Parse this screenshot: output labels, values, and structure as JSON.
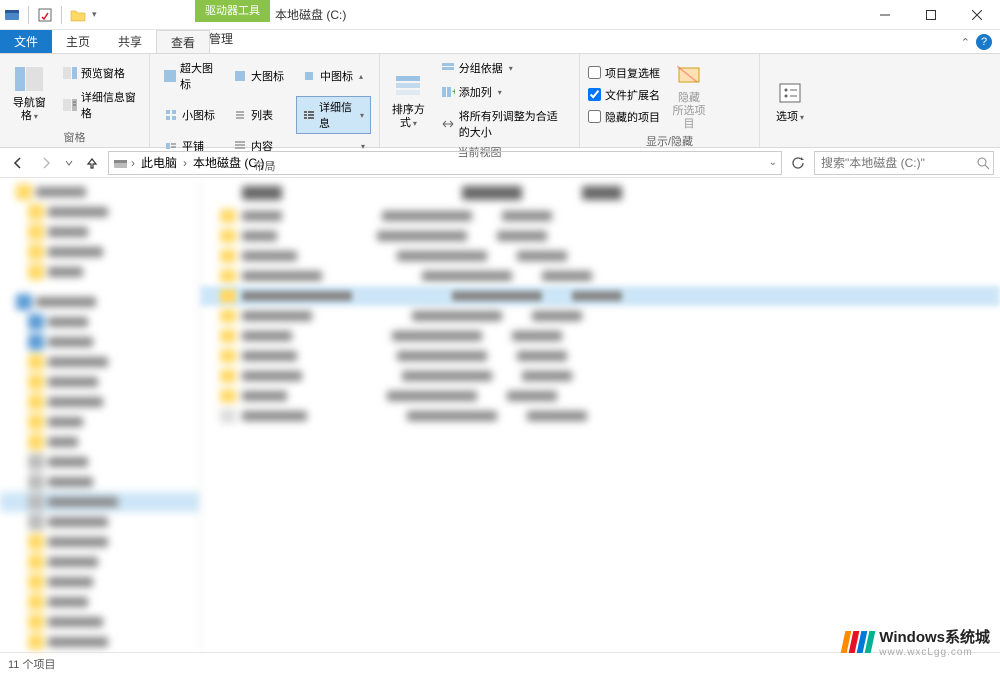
{
  "window": {
    "drive_tools": "驱动器工具",
    "title": "本地磁盘 (C:)"
  },
  "tabs": {
    "file": "文件",
    "home": "主页",
    "share": "共享",
    "view": "查看",
    "manage": "管理"
  },
  "ribbon": {
    "panes": {
      "nav_pane": "导航窗格",
      "preview_pane": "预览窗格",
      "details_pane": "详细信息窗格",
      "group_label": "窗格"
    },
    "layout": {
      "extra_large": "超大图标",
      "large": "大图标",
      "medium": "中图标",
      "small": "小图标",
      "list": "列表",
      "details": "详细信息",
      "tiles": "平铺",
      "content": "内容",
      "group_label": "布局"
    },
    "current_view": {
      "sort_by": "排序方式",
      "group_by": "分组依据",
      "add_columns": "添加列",
      "size_all": "将所有列调整为合适的大小",
      "group_label": "当前视图"
    },
    "show_hide": {
      "item_checkboxes": "项目复选框",
      "file_extensions": "文件扩展名",
      "hidden_items": "隐藏的项目",
      "checkbox_state": false,
      "ext_state": true,
      "hidden_state": false,
      "hide_selected": "隐藏",
      "hide_selected_sub": "所选项目",
      "group_label": "显示/隐藏"
    },
    "options": {
      "label": "选项"
    }
  },
  "breadcrumb": {
    "this_pc": "此电脑",
    "drive": "本地磁盘 (C:)"
  },
  "search": {
    "placeholder": "搜索\"本地磁盘 (C:)\""
  },
  "statusbar": {
    "items": "11 个项目"
  },
  "watermark": {
    "title": "Windows系统城",
    "url": "www.wxcLgg.com",
    "colors": [
      "#ff8c00",
      "#e81123",
      "#0078d7",
      "#00b294"
    ]
  }
}
